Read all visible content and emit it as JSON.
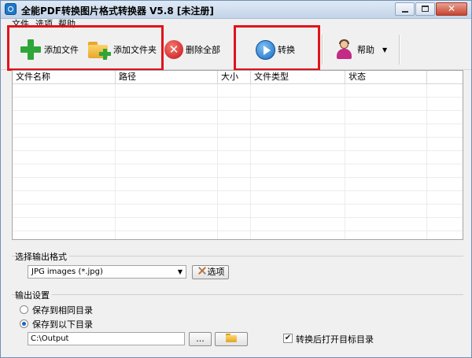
{
  "window": {
    "title": "全能PDF转换图片格式转换器 V5.8 [未注册]",
    "close_glyph": "✕"
  },
  "menu": {
    "items": [
      "文件",
      "选项",
      "帮助"
    ]
  },
  "toolbar": {
    "add_file": "添加文件",
    "add_folder": "添加文件夹",
    "delete_all": "删除全部",
    "delete_glyph": "✕",
    "convert": "转换",
    "help": "帮助",
    "help_arrow": "▼"
  },
  "file_list": {
    "columns": [
      "文件名称",
      "路径",
      "大小",
      "文件类型",
      "状态"
    ]
  },
  "output_format": {
    "group_label": "选择输出格式",
    "selected": "JPG images (*.jpg)",
    "caret": "▼",
    "options_button": "选项"
  },
  "output_settings": {
    "group_label": "输出设置",
    "same_dir_label": "保存到相同目录",
    "custom_dir_label": "保存到以下目录",
    "path_value": "C:\\Output",
    "browse_button": "...",
    "open_after_label": "转换后打开目标目录",
    "open_after_check": "✔"
  },
  "colors": {
    "highlight": "#e0141c",
    "accent_blue": "#1b6cc4",
    "green": "#2ea638"
  }
}
